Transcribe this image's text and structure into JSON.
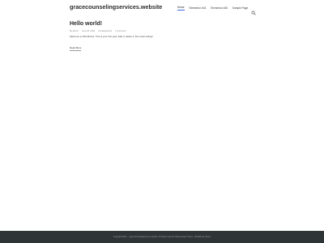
{
  "header": {
    "site_title": "gracecounselingservices.website",
    "nav": [
      {
        "label": "Home",
        "active": true
      },
      {
        "label": "Elementor #43",
        "active": false
      },
      {
        "label": "Elementor #46",
        "active": false
      },
      {
        "label": "Sample Page",
        "active": false
      }
    ],
    "search_icon": "search-icon"
  },
  "post": {
    "title": "Hello world!",
    "meta": {
      "author": "By admin",
      "date": "June 28, 2023",
      "category": "Uncategorized",
      "comments": "1 Comment"
    },
    "excerpt": "Welcome to WordPress. This is your first post. Edit or delete it, then start writing!",
    "read_more": "Read More"
  },
  "footer": {
    "text": "Copyright 2023 — gracecounselingservices.website. All rights reserved. Bosa Lawyer Theme · WordPress Theme"
  },
  "colors": {
    "accent": "#4169e1",
    "footer_bg": "#2f3436"
  }
}
